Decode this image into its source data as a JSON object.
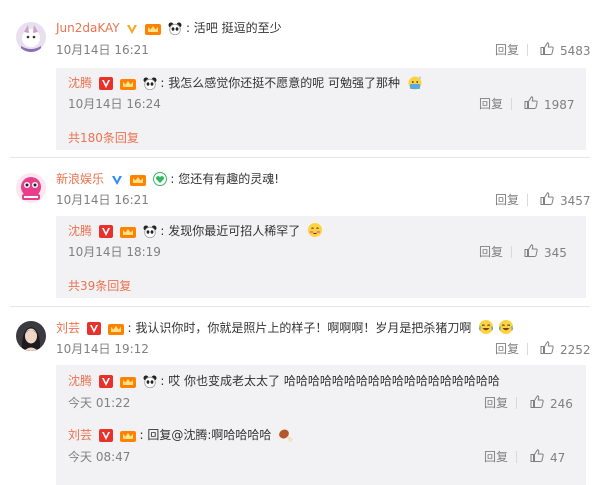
{
  "actions": {
    "reply": "回复"
  },
  "comments": [
    {
      "user": "Jun2daKAY",
      "text": "活吧 挺逗的至少",
      "time": "10月14日 16:21",
      "likes": "5483",
      "replies": [
        {
          "user": "沈腾",
          "text": "我怎么感觉你还挺不愿意的呢 可勉强了那种",
          "time": "10月14日 16:24",
          "likes": "1987"
        }
      ],
      "more_replies": "共180条回复"
    },
    {
      "user": "新浪娱乐",
      "text": "您还有有趣的灵魂!",
      "time": "10月14日 16:21",
      "likes": "3457",
      "replies": [
        {
          "user": "沈腾",
          "text": "发现你最近可招人稀罕了",
          "time": "10月14日 18:19",
          "likes": "345"
        }
      ],
      "more_replies": "共39条回复"
    },
    {
      "user": "刘芸",
      "text": "我认识你时，你就是照片上的样子！啊啊啊！岁月是把杀猪刀啊",
      "time": "10月14日 19:12",
      "likes": "2252",
      "replies": [
        {
          "user": "沈腾",
          "text": "哎 你也变成老太太了 哈哈哈哈哈哈哈哈哈哈哈哈哈哈哈哈哈哈",
          "time": "今天 01:22",
          "likes": "246"
        },
        {
          "user": "刘芸",
          "text": "回复@沈腾:啊哈哈哈哈",
          "time": "今天 08:47",
          "likes": "47"
        }
      ]
    }
  ],
  "colors": {
    "username": "#eb7350",
    "meta": "#808080",
    "reply_bg": "#f2f2f5",
    "vip_orange": "#f5a623",
    "verify_blue": "#2d8cf0"
  },
  "icons": [
    "vip-v-icon",
    "vip-crown-icon",
    "panda-icon",
    "thumbs-up-icon",
    "emoji-sweat-icon",
    "emoji-blush-icon",
    "emoji-laugh-cry-icon",
    "drumstick-icon",
    "verified-blue-v-icon",
    "green-heart-badge-icon"
  ]
}
